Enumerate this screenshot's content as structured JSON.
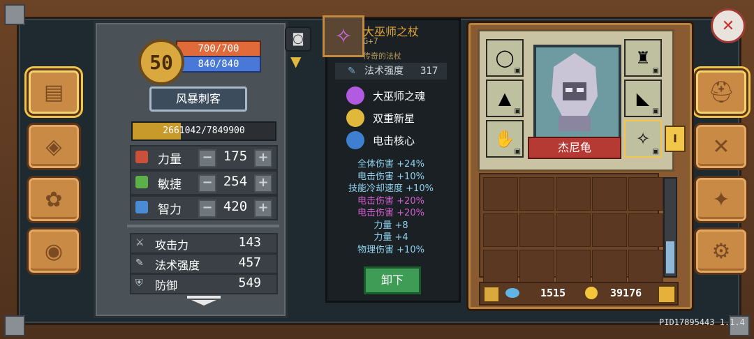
{
  "level": "50",
  "hp": "700/700",
  "mp": "840/840",
  "class_name": "风暴刺客",
  "xp": {
    "text": "2661042/7849900",
    "fraction": 0.34
  },
  "attributes": [
    {
      "label": "力量",
      "value": "175",
      "color": "#c9503a"
    },
    {
      "label": "敏捷",
      "value": "254",
      "color": "#5bb04a"
    },
    {
      "label": "智力",
      "value": "420",
      "color": "#4a8bd6"
    }
  ],
  "stats": [
    {
      "label": "攻击力",
      "value": "143",
      "icon": "sword-icon"
    },
    {
      "label": "法术强度",
      "value": "457",
      "icon": "wand-icon"
    },
    {
      "label": "防御",
      "value": "549",
      "icon": "shield-icon"
    }
  ],
  "item": {
    "name": "大巫师之杖",
    "grade": "G+7",
    "type": "传奇的法杖",
    "main_stat_label": "法术强度",
    "main_stat_value": "317",
    "skills": [
      {
        "label": "大巫师之魂",
        "color": "#b25be0"
      },
      {
        "label": "双重新星",
        "color": "#e0b83c"
      },
      {
        "label": "电击核心",
        "color": "#3f7fd0"
      }
    ],
    "bonuses": [
      {
        "text": "全体伤害 +24%",
        "color": "#8fd3f0"
      },
      {
        "text": "电击伤害 +10%",
        "color": "#8fd3f0"
      },
      {
        "text": "技能冷却速度 +10%",
        "color": "#8fd3f0"
      },
      {
        "text": "电击伤害 +20%",
        "color": "#d25fd2"
      },
      {
        "text": "电击伤害 +20%",
        "color": "#d25fd2"
      },
      {
        "text": "力量 +8",
        "color": "#8fd3f0"
      },
      {
        "text": "力量 +4",
        "color": "#8fd3f0"
      },
      {
        "text": "物理伤害 +10%",
        "color": "#8fd3f0"
      }
    ],
    "unequip_label": "卸下"
  },
  "hero_name": "杰尼龟",
  "currency": {
    "gems": "1515",
    "gold": "39176"
  },
  "pid": "PID17895443 1.1.4",
  "tab_marker": "I"
}
